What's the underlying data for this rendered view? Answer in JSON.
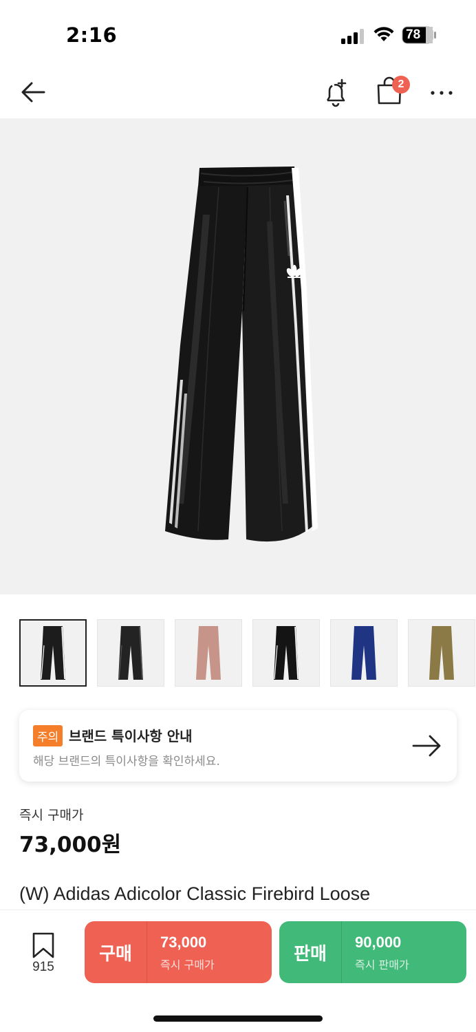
{
  "status_bar": {
    "time": "2:16",
    "battery": "78"
  },
  "nav": {
    "cart_count": "2"
  },
  "icons": {
    "back": "arrow-left-icon",
    "alert": "bell-plus-icon",
    "cart": "shopping-bag-icon",
    "more": "more-horizontal-icon",
    "notice_arrow": "arrow-right-icon",
    "wish": "bookmark-icon"
  },
  "colors": {
    "buy": "#ef6253",
    "sell": "#41b979",
    "notice_tag": "#f47e2a",
    "hero_bg": "#f1f1f1"
  },
  "thumbnails": [
    {
      "color_name": "black",
      "pants": "#1c1c1c",
      "stripe": "#ffffff",
      "selected": true
    },
    {
      "color_name": "black-pinstripe",
      "pants": "#232323",
      "stripe": "#555555",
      "selected": false
    },
    {
      "color_name": "pink",
      "pants": "#c69488",
      "stripe": "#c69488",
      "selected": false
    },
    {
      "color_name": "black-white",
      "pants": "#141414",
      "stripe": "#ffffff",
      "selected": false
    },
    {
      "color_name": "navy",
      "pants": "#1f3584",
      "stripe": "#1f3584",
      "selected": false
    },
    {
      "color_name": "olive",
      "pants": "#8b7a45",
      "stripe": "#8b7a45",
      "selected": false
    }
  ],
  "notice": {
    "tag": "주의",
    "title": "브랜드 특이사항 안내",
    "subtitle": "해당 브랜드의 특이사항을 확인하세요."
  },
  "price": {
    "label": "즉시 구매가",
    "value": "73,000원"
  },
  "product": {
    "name": "(W) Adidas Adicolor Classic Firebird Loose"
  },
  "bottom": {
    "wish_count": "915",
    "buy": {
      "label": "구매",
      "price": "73,000",
      "sub": "즉시 구매가"
    },
    "sell": {
      "label": "판매",
      "price": "90,000",
      "sub": "즉시 판매가"
    }
  }
}
